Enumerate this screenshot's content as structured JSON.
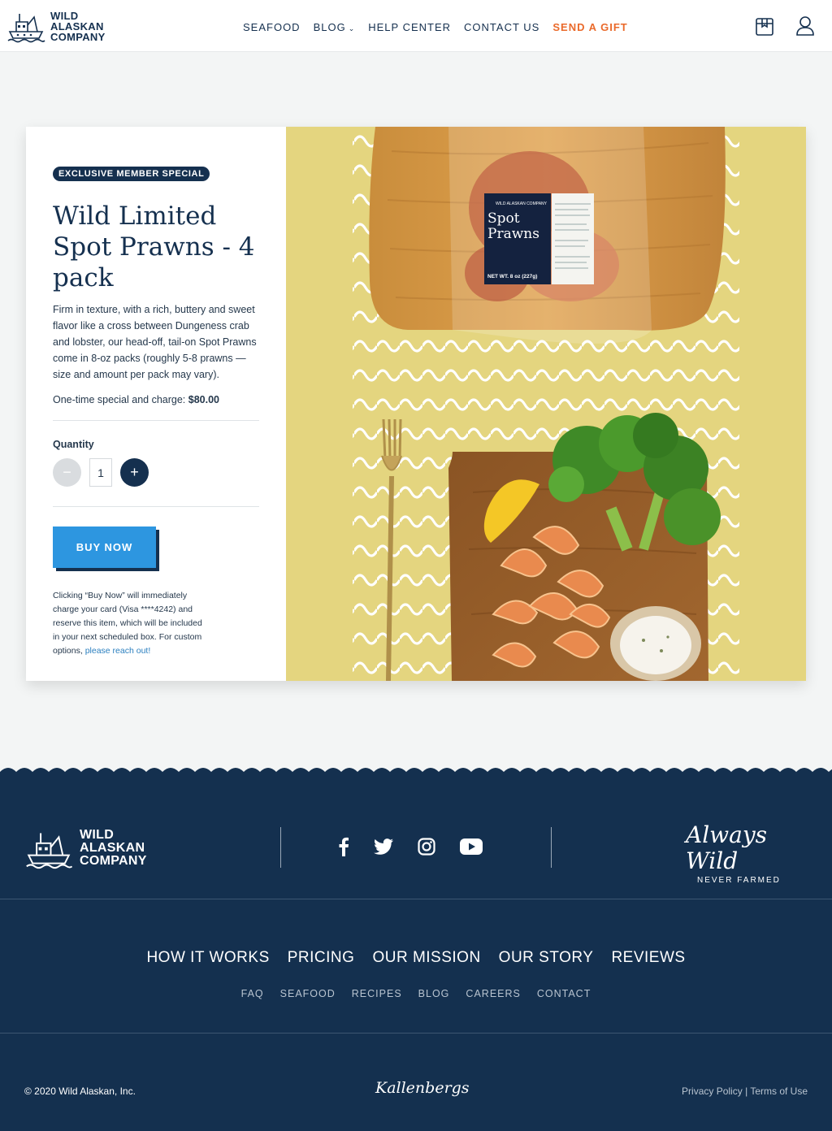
{
  "header": {
    "logo_lines": [
      "WILD",
      "ALASKAN",
      "COMPANY"
    ],
    "nav": [
      {
        "label": "SEAFOOD"
      },
      {
        "label": "BLOG"
      },
      {
        "label": "HELP CENTER"
      },
      {
        "label": "CONTACT US"
      },
      {
        "label": "SEND A GIFT"
      }
    ],
    "icons": [
      "box-icon",
      "user-icon"
    ],
    "gift_color": "#ea6a2b"
  },
  "product": {
    "badge": "EXCLUSIVE MEMBER SPECIAL",
    "title": "Wild Limited Spot Prawns - 4 pack",
    "description": "Firm in texture, with a rich, buttery and sweet flavor like a cross between Dungeness crab and lobster, our head-off, tail-on Spot Prawns come in 8-oz packs (roughly 5-8 prawns — size and amount per pack may vary).",
    "price_prefix": "One-time special and charge: ",
    "price": "$80.00",
    "quantity_label": "Quantity",
    "quantity_value": "1",
    "minus_symbol": "−",
    "plus_symbol": "+",
    "buy_label": "BUY NOW",
    "note_text": "Clicking “Buy Now” will immediately charge your card (Visa ****4242) and reserve this item, which will be included in your next scheduled box. For custom options, ",
    "note_link": "please reach out!",
    "package_label_top": "WILD ALASKAN COMPANY",
    "package_label": "Spot Prawns",
    "package_weight": "NET WT. 8 oz (227g)",
    "accent": "#2d96e0",
    "navy": "#15304f",
    "photo_bg": "#e4d57f"
  },
  "footer": {
    "logo_lines": [
      "WILD",
      "ALASKAN",
      "COMPANY"
    ],
    "socials": [
      "facebook-icon",
      "twitter-icon",
      "instagram-icon",
      "youtube-icon"
    ],
    "tagline_script": "Always Wild",
    "tagline_small": "NEVER FARMED",
    "main_links": [
      "HOW IT WORKS",
      "PRICING",
      "OUR MISSION",
      "OUR STORY",
      "REVIEWS"
    ],
    "sub_links": [
      "FAQ",
      "SEAFOOD",
      "RECIPES",
      "BLOG",
      "CAREERS",
      "CONTACT"
    ],
    "copyright": "© 2020 Wild Alaskan, Inc.",
    "credit": "Kallenbergs",
    "privacy": "Privacy Policy",
    "separator": "|",
    "terms": "Terms of Use",
    "bg": "#14304f"
  }
}
